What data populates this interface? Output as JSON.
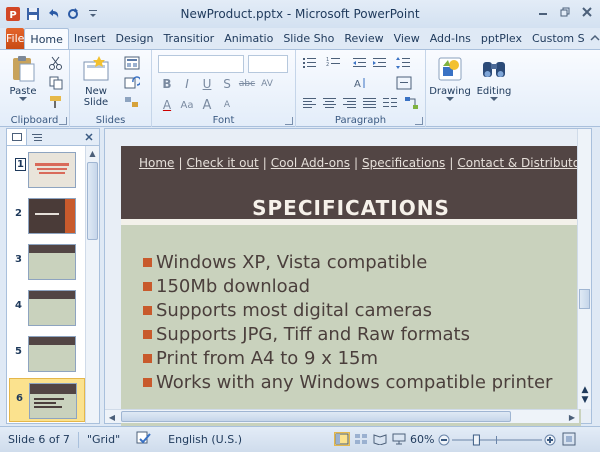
{
  "window": {
    "title": "NewProduct.pptx - Microsoft PowerPoint",
    "app_icon": "powerpoint-icon",
    "controls": [
      "minimize-icon",
      "restore-icon",
      "close-icon"
    ]
  },
  "quick_access": [
    "save-icon",
    "undo-icon",
    "redo-icon",
    "customize-icon"
  ],
  "tabs": [
    {
      "label": "File"
    },
    {
      "label": "Home"
    },
    {
      "label": "Insert"
    },
    {
      "label": "Design"
    },
    {
      "label": "Transitior"
    },
    {
      "label": "Animatio"
    },
    {
      "label": "Slide Sho"
    },
    {
      "label": "Review"
    },
    {
      "label": "View"
    },
    {
      "label": "Add-Ins"
    },
    {
      "label": "pptPlex"
    },
    {
      "label": "Custom S"
    }
  ],
  "ribbon": {
    "groups": {
      "clipboard": "Clipboard",
      "slides": "Slides",
      "font": "Font",
      "paragraph": "Paragraph"
    },
    "buttons": {
      "paste": "Paste",
      "new_slide": "New Slide",
      "drawing": "Drawing",
      "editing": "Editing"
    },
    "format_row1": [
      "B",
      "I",
      "U",
      "S",
      "abc",
      "AV"
    ],
    "format_row2": [
      "A",
      "Aa",
      "A",
      "A"
    ]
  },
  "thumbnails": [
    {
      "num": "1",
      "icon": "slide-number-icon"
    },
    {
      "num": "2"
    },
    {
      "num": "3"
    },
    {
      "num": "4"
    },
    {
      "num": "5"
    },
    {
      "num": "6"
    }
  ],
  "slide": {
    "nav": [
      "Home",
      "Check it out",
      "Cool Add-ons",
      "Specifications",
      "Contact & Distributo"
    ],
    "title": "SPECIFICATIONS",
    "bullets": [
      "Windows XP, Vista compatible",
      "150Mb download",
      "Supports most digital cameras",
      "Supports JPG, Tiff and Raw formats",
      "Print from A4 to 9 x 15m",
      "Works with any Windows compatible printer"
    ],
    "colors": {
      "header": "#524544",
      "body": "#c9d2bd",
      "bullet": "#c85a2c",
      "text": "#4b3f3c"
    }
  },
  "status": {
    "slide": "Slide 6 of 7",
    "theme": "\"Grid\"",
    "language": "English (U.S.)",
    "zoom": "60%",
    "zoom_value": 0.6
  }
}
